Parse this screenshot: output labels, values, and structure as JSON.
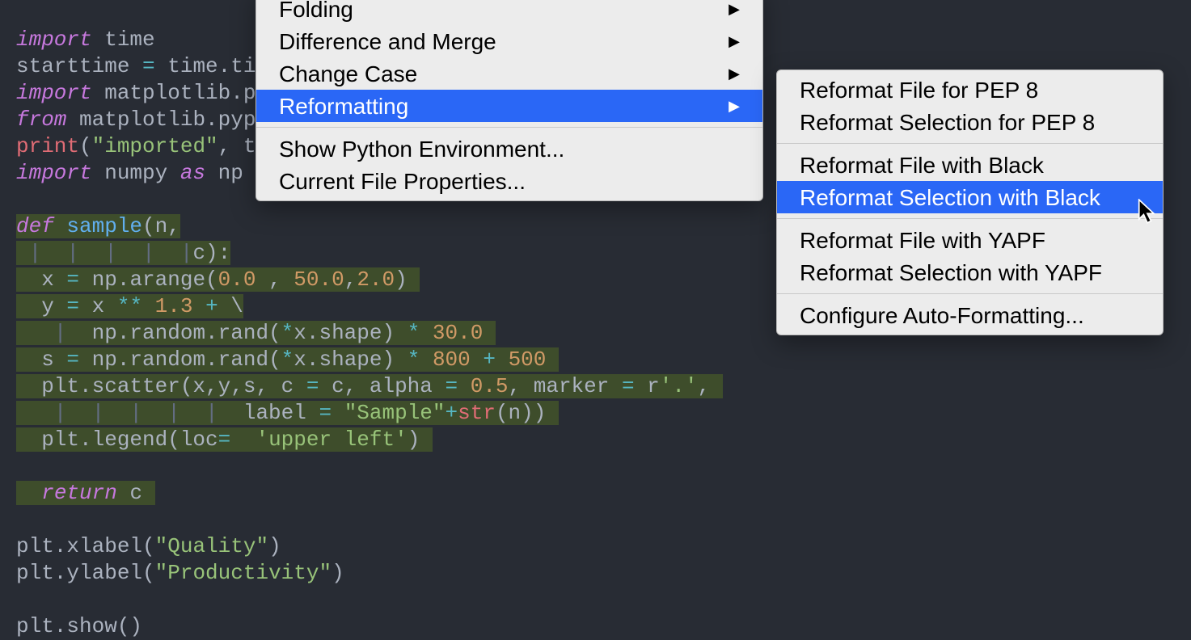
{
  "code": {
    "l1": "import",
    "l1b": " time",
    "l2a": "starttime ",
    "l2op": "=",
    "l2b": " time.ti",
    "l3": "import",
    "l3b": " matplotlib.p",
    "l4a": "from",
    "l4b": " matplotlib.pyp",
    "l5a": "print",
    "l5p": "(",
    "l5s": "\"imported\"",
    "l5c": ", t",
    "l6": "import",
    "l6b": " numpy ",
    "l6as": "as",
    "l6c": " np",
    "l8def": "def ",
    "l8name": "sample",
    "l8p": "(n,",
    "l9g": " |  |  |  |  |",
    "l9b": "c):",
    "l10a": "  x ",
    "l10op": "=",
    "l10b": " np.arange(",
    "l10n1": "0.0",
    "l10c1": " , ",
    "l10n2": "50.0",
    "l10c2": ",",
    "l10n3": "2.0",
    "l10end": ") ",
    "l11a": "  y ",
    "l11op": "=",
    "l11b": " x ",
    "l11op2": "**",
    "l11sp": " ",
    "l11n": "1.3",
    "l11c": " ",
    "l11plus": "+",
    "l11bs": " \\",
    "l12g": "   | ",
    "l12a": " np.random.rand(",
    "l12op": "*",
    "l12b": "x.shape) ",
    "l12op2": "*",
    "l12sp": " ",
    "l12n": "30.0",
    "l12end": " ",
    "l13a": "  s ",
    "l13op": "=",
    "l13b": " np.random.rand(",
    "l13op2": "*",
    "l13c": "x.shape) ",
    "l13op3": "*",
    "l13sp": " ",
    "l13n1": "800",
    "l13sp2": " ",
    "l13plus": "+",
    "l13sp3": " ",
    "l13n2": "500",
    "l13end": " ",
    "l14a": "  plt.scatter(x,y,s, c ",
    "l14op": "=",
    "l14b": " c, alpha ",
    "l14op2": "=",
    "l14sp": " ",
    "l14n": "0.5",
    "l14c": ", marker ",
    "l14op3": "=",
    "l14r": " r",
    "l14s": "'.'",
    "l14end": ", ",
    "l15g": "   |  |  |  |  | ",
    "l15a": " label ",
    "l15op": "=",
    "l15sp": " ",
    "l15s": "\"Sample\"",
    "l15plus": "+",
    "l15str": "str",
    "l15p": "(n)) ",
    "l16a": "  plt.legend(loc",
    "l16op": "=",
    "l16sp": "  ",
    "l16s": "'upper left'",
    "l16end": ") ",
    "l18a": "  ",
    "l18ret": "return",
    "l18b": " c ",
    "l20a": "plt.xlabel(",
    "l20s": "\"Quality\"",
    "l20end": ")",
    "l21a": "plt.ylabel(",
    "l21s": "\"Productivity\"",
    "l21end": ")",
    "l23a": "plt.show()"
  },
  "menu1": {
    "i0": "Folding",
    "i1": "Difference and Merge",
    "i2": "Change Case",
    "i3": "Reformatting",
    "i4": "Show Python Environment...",
    "i5": "Current File Properties..."
  },
  "menu2": {
    "i0": "Reformat File for PEP 8",
    "i1": "Reformat Selection for PEP 8",
    "i2": "Reformat File with Black",
    "i3": "Reformat Selection with Black",
    "i4": "Reformat File with YAPF",
    "i5": "Reformat Selection with YAPF",
    "i6": "Configure Auto-Formatting..."
  }
}
